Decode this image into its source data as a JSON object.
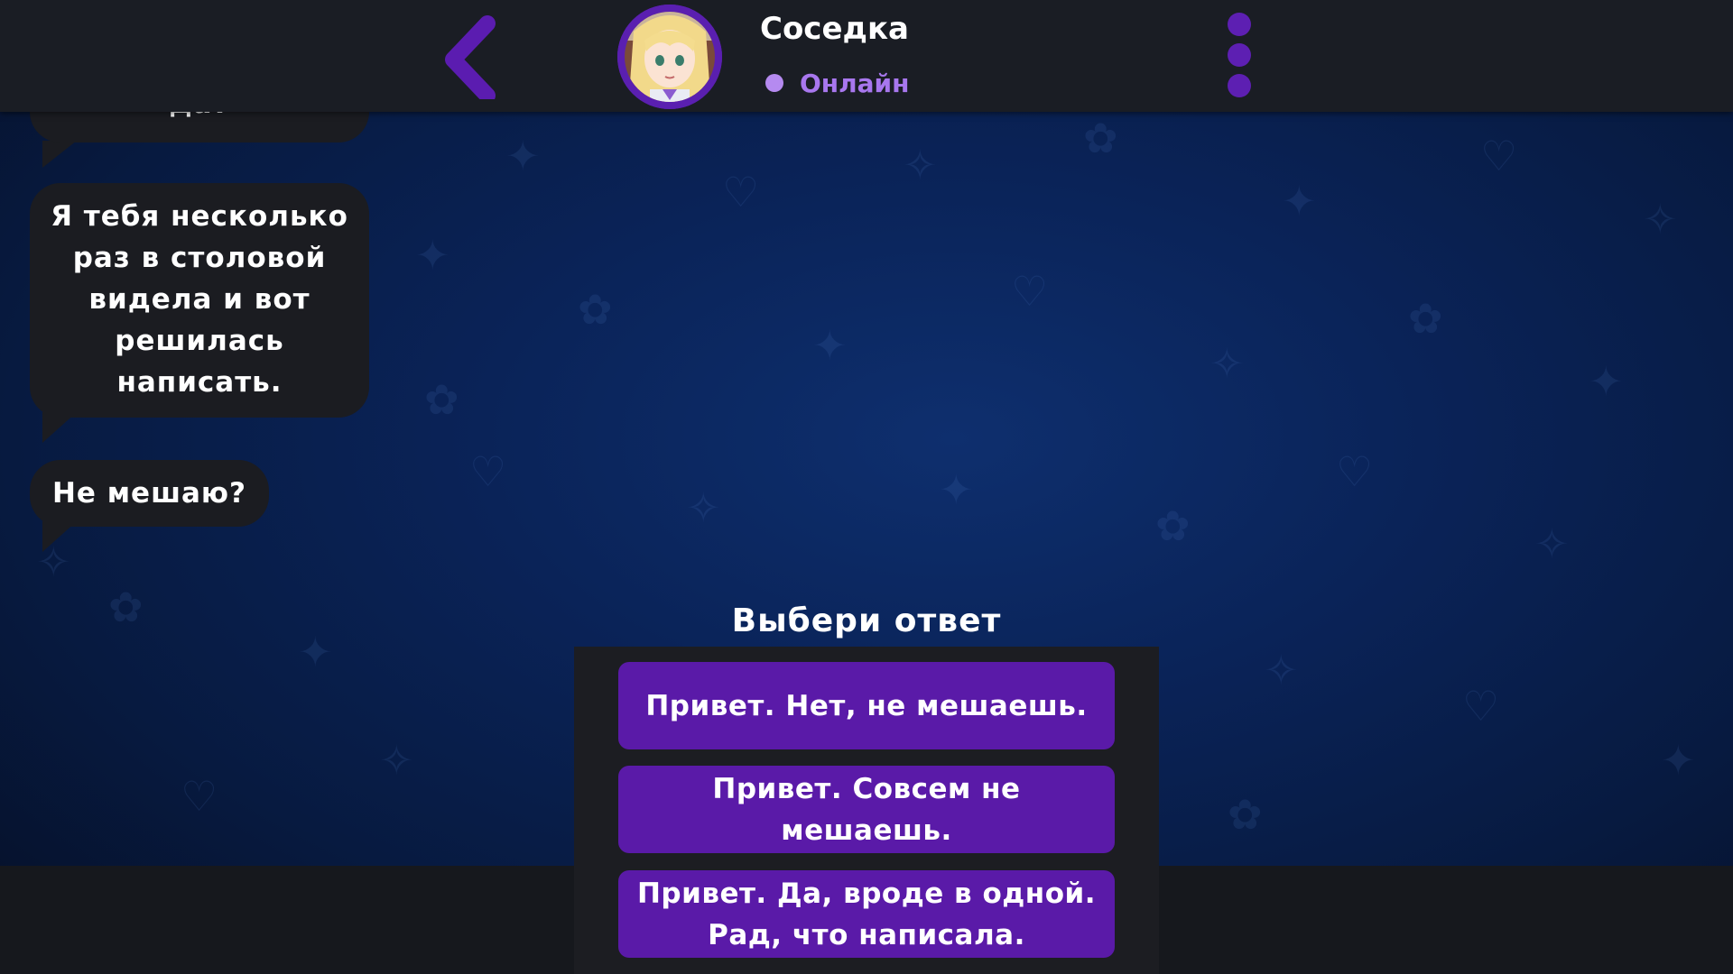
{
  "header": {
    "contact_name": "Соседка",
    "status": "Онлайн"
  },
  "messages": [
    {
      "text": "да?"
    },
    {
      "text": "Я тебя несколько раз в столовой видела и вот решилась написать."
    },
    {
      "text": "Не мешаю?"
    }
  ],
  "choices": {
    "title": "Выбери ответ",
    "options": [
      "Привет. Нет, не мешаешь.",
      "Привет. Совсем не мешаешь.",
      "Привет. Да, вроде в одной. Рад, что написала."
    ]
  },
  "colors": {
    "accent": "#5a1aa8",
    "status": "#a877ee",
    "bubble": "#1b1c21",
    "header": "#1a1d24"
  },
  "icons": [
    "back-arrow-icon",
    "more-vertical-icon",
    "online-dot-icon"
  ]
}
